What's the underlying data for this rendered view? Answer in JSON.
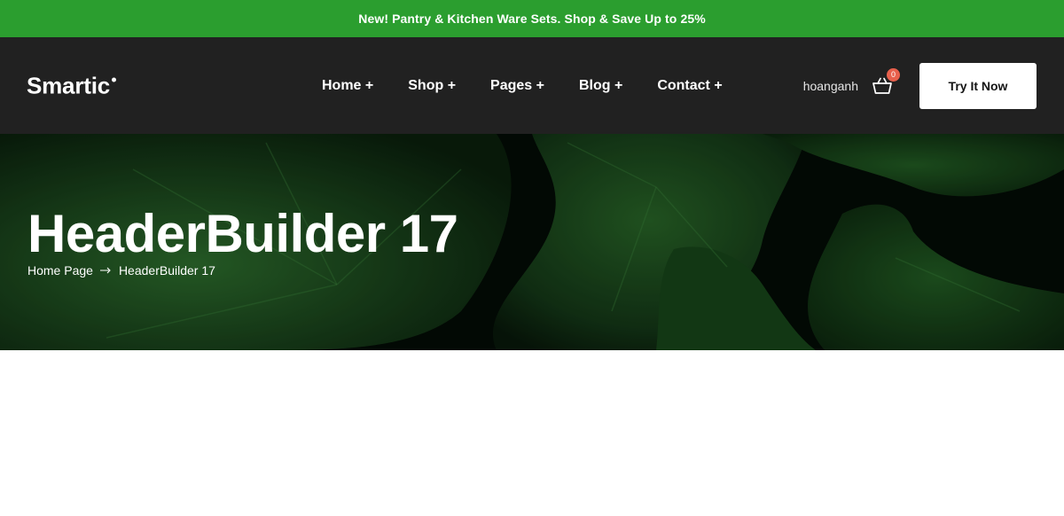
{
  "colors": {
    "promo_bg": "#2b9e2f",
    "header_bg": "#212121",
    "badge_bg": "#e8604c",
    "hero_dark": "#020a04",
    "leaf_green": "#1f5a22"
  },
  "promo": {
    "text": "New! Pantry & Kitchen Ware Sets. Shop & Save Up to 25%"
  },
  "header": {
    "logo": "Smartic",
    "nav": [
      {
        "label": "Home +"
      },
      {
        "label": "Shop +"
      },
      {
        "label": "Pages +"
      },
      {
        "label": "Blog +"
      },
      {
        "label": "Contact +"
      }
    ],
    "user": "hoanganh",
    "cart_icon": "basket-icon",
    "cart_count": "0",
    "cta_label": "Try It Now"
  },
  "hero": {
    "title": "HeaderBuilder 17",
    "breadcrumb": {
      "home": "Home Page",
      "separator_icon": "arrow-right-icon",
      "current": "HeaderBuilder 17"
    }
  }
}
